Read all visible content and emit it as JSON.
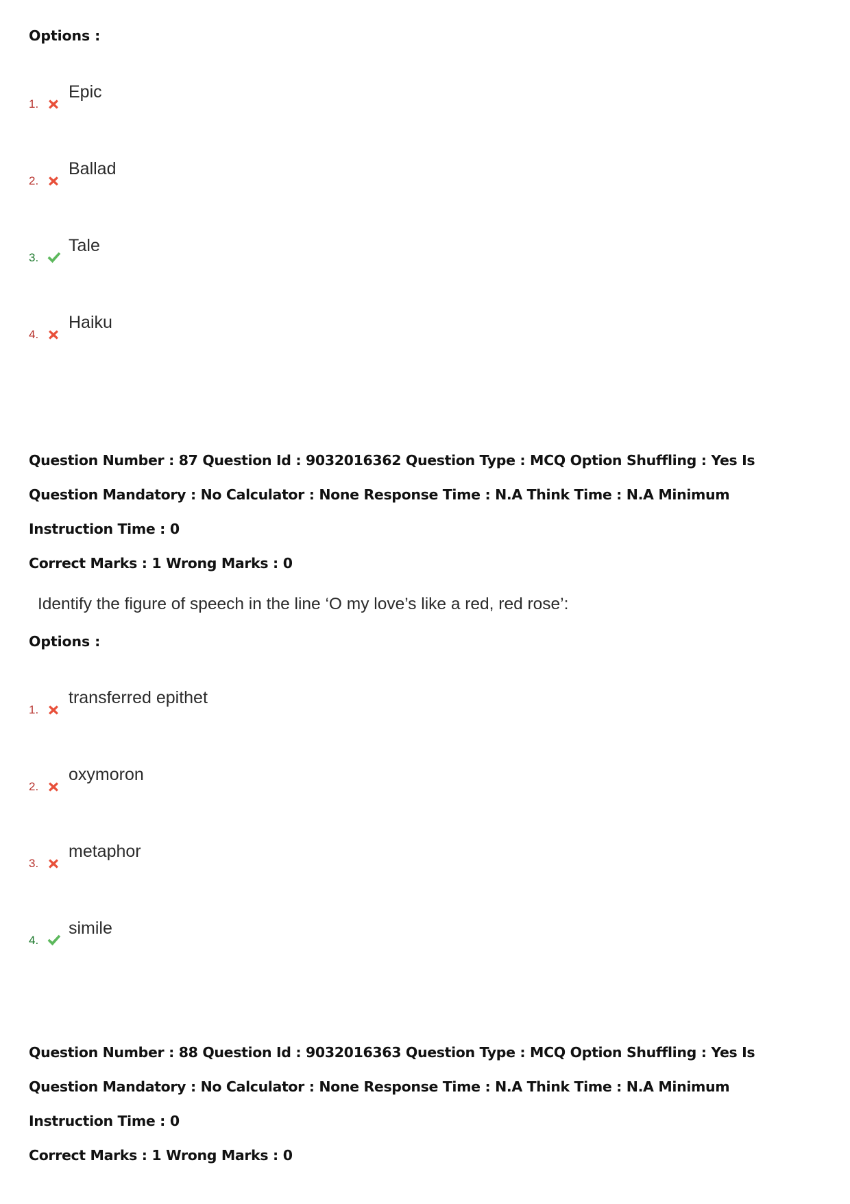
{
  "page": {
    "options_heading": "Options :"
  },
  "question_86_options": {
    "heading": "Options :",
    "items": [
      {
        "number": "1.",
        "text": "Epic",
        "mark": "cross-icon",
        "correct": false
      },
      {
        "number": "2.",
        "text": "Ballad",
        "mark": "cross-icon",
        "correct": false
      },
      {
        "number": "3.",
        "text": "Tale",
        "mark": "check-icon",
        "correct": true
      },
      {
        "number": "4.",
        "text": "Haiku",
        "mark": "cross-icon",
        "correct": false
      }
    ]
  },
  "question_87": {
    "meta_line_1": "Question Number : 87 Question Id : 9032016362 Question Type : MCQ Option Shuffling : Yes Is",
    "meta_line_2": "Question Mandatory : No Calculator : None Response Time : N.A Think Time : N.A Minimum",
    "meta_line_3": "Instruction Time : 0",
    "meta_line_4": "Correct Marks : 1 Wrong Marks : 0",
    "stem": "Identify the figure of speech in the line ‘O my love’s like a red, red rose’:",
    "options_heading": "Options :",
    "options": [
      {
        "number": "1.",
        "text": "transferred epithet",
        "mark": "cross-icon",
        "correct": false
      },
      {
        "number": "2.",
        "text": "oxymoron",
        "mark": "cross-icon",
        "correct": false
      },
      {
        "number": "3.",
        "text": "metaphor",
        "mark": "cross-icon",
        "correct": false
      },
      {
        "number": "4.",
        "text": "simile",
        "mark": "check-icon",
        "correct": true
      }
    ]
  },
  "question_88": {
    "meta_line_1": "Question Number : 88 Question Id : 9032016363 Question Type : MCQ Option Shuffling : Yes Is",
    "meta_line_2": "Question Mandatory : No Calculator : None Response Time : N.A Think Time : N.A Minimum",
    "meta_line_3": "Instruction Time : 0",
    "meta_line_4": "Correct Marks : 1 Wrong Marks : 0"
  },
  "colors": {
    "wrong_red": "#e8503a",
    "wrong_num_red": "#b7312c",
    "correct_green": "#5cb85c",
    "correct_num_green": "#1f7a2e",
    "meta_text": "#111111",
    "body_text": "#2b2b2b"
  }
}
